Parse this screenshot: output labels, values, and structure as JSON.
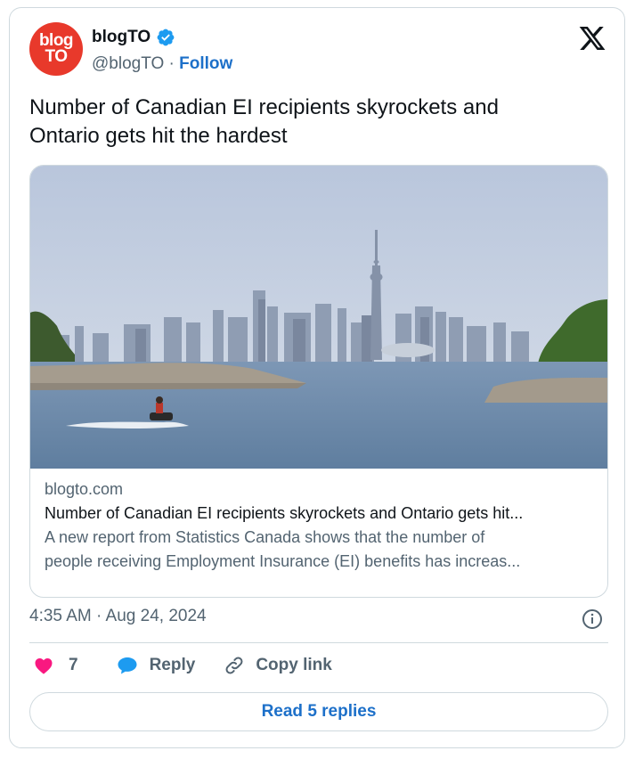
{
  "author": {
    "avatar_text_top": "blog",
    "avatar_text_bottom": "TO",
    "name": "blogTO",
    "handle": "@blogTO",
    "separator": "·",
    "follow_label": "Follow",
    "verified": true
  },
  "tweet": {
    "text_line1": "Number of Canadian EI recipients skyrockets and",
    "text_line2": "Ontario gets hit the hardest",
    "timestamp": "4:35 AM · Aug 24, 2024"
  },
  "link_card": {
    "image_icon": "toronto-skyline-photo",
    "domain": "blogto.com",
    "title": "Number of Canadian EI recipients skyrockets and Ontario gets hit...",
    "description_line1": "A new report from Statistics Canada shows that the number of",
    "description_line2": "people receiving Employment Insurance (EI) benefits has increas..."
  },
  "actions": {
    "like_count": "7",
    "reply_label": "Reply",
    "copy_link_label": "Copy link",
    "read_replies_label": "Read 5 replies"
  },
  "colors": {
    "brand_red": "#e8392b",
    "link_blue": "#1d70c9",
    "like_pink": "#f91880",
    "verified_blue": "#1d9bf0"
  },
  "icons": [
    "verified-badge-icon",
    "x-logo-icon",
    "info-icon",
    "heart-icon",
    "reply-bubble-icon",
    "link-icon"
  ]
}
